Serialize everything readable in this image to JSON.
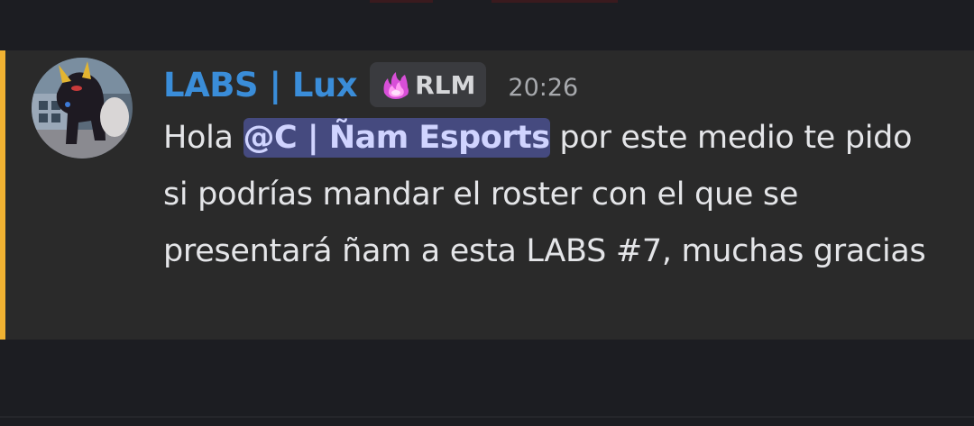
{
  "message": {
    "username": "LABS | Lux",
    "role_badge": "RLM",
    "timestamp": "20:26",
    "text_before_mention": "Hola ",
    "mention": "@C | Ñam Esports",
    "text_after_mention": "  por este medio te pido si podrías mandar el roster con el que se presentará ñam a esta LABS #7, muchas gracias"
  },
  "colors": {
    "username": "#3a8dd9",
    "mention_highlight": "#f0b232",
    "mention_pill": "#454a7f",
    "message_background": "#2a2a2a",
    "page_background": "#1c1d22"
  },
  "icons": {
    "role_icon": "pink-flame-icon",
    "avatar": "user-avatar-image"
  }
}
